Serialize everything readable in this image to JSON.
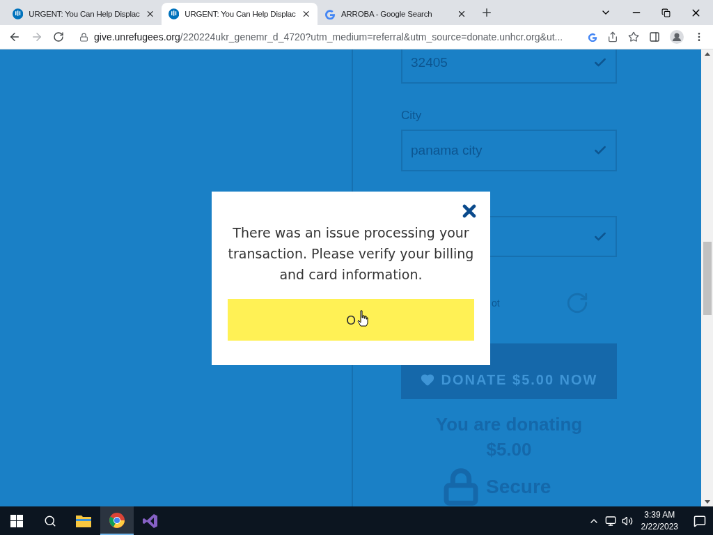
{
  "browser": {
    "tabs": [
      {
        "title": "URGENT: You Can Help Displac",
        "kind": "unhcr",
        "selected": false
      },
      {
        "title": "URGENT: You Can Help Displac",
        "kind": "unhcr",
        "selected": true
      },
      {
        "title": "ARROBA - Google Search",
        "kind": "google",
        "selected": false
      }
    ],
    "url": {
      "host": "give.unrefugees.org",
      "path": "/220224ukr_genemr_d_4720?utm_medium=referral&utm_source=donate.unhcr.org&ut..."
    }
  },
  "form": {
    "fields": [
      {
        "value": "32405",
        "valid": true
      },
      {
        "label": "City",
        "value": "panama city",
        "valid": true
      },
      {
        "valid": true
      }
    ],
    "captcha_text": "ot",
    "donate_button": "DONATE $5.00 NOW",
    "summary": [
      "You are donating",
      "$5.00"
    ],
    "secure_label": "Secure"
  },
  "dialog": {
    "message": "There was an issue processing your transaction. Please verify your billing and card information.",
    "ok_button": "O"
  },
  "taskbar": {
    "apps": [
      {
        "kind": "explorer",
        "selected": false
      },
      {
        "kind": "chrome",
        "selected": true
      },
      {
        "kind": "studio",
        "selected": false
      }
    ],
    "time": "3:39 AM",
    "date": "2/22/2023"
  }
}
